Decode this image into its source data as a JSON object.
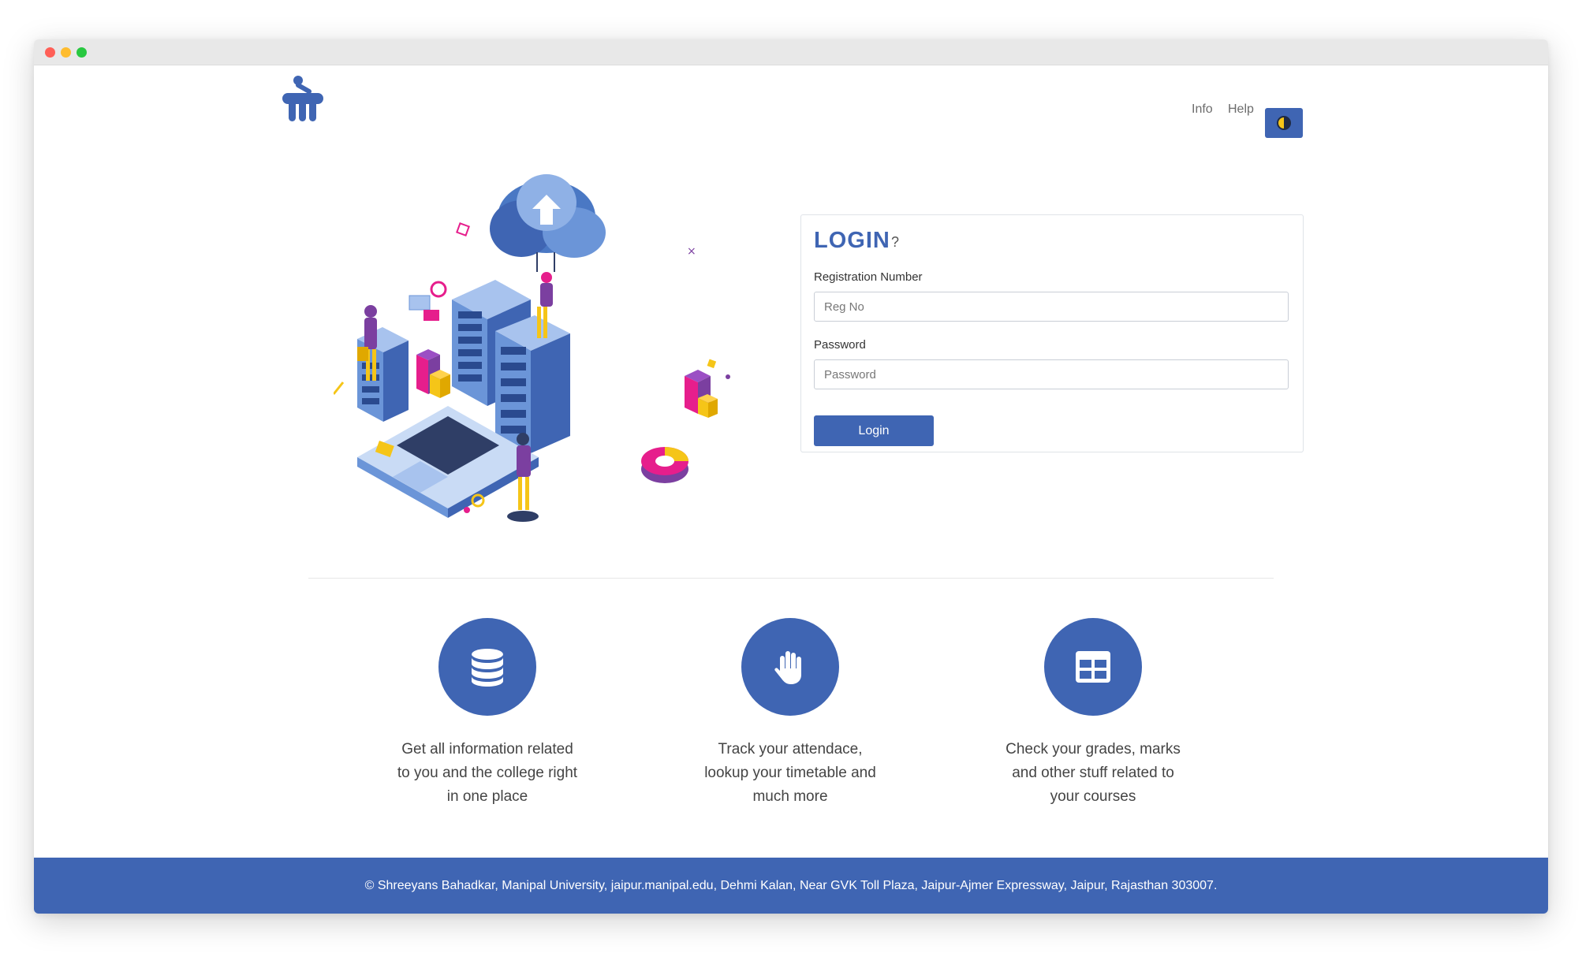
{
  "nav": {
    "info_label": "Info",
    "help_label": "Help",
    "theme_toggle_icon": "contrast-icon"
  },
  "login": {
    "title": "LOGIN",
    "help_mark": "?",
    "reg_label": "Registration Number",
    "reg_placeholder": "Reg No",
    "reg_value": "",
    "password_label": "Password",
    "password_placeholder": "Password",
    "password_value": "",
    "button_label": "Login"
  },
  "features": [
    {
      "icon": "database-icon",
      "lines": [
        "Get all information related",
        "to you and the college right",
        "in one place"
      ]
    },
    {
      "icon": "hand-icon",
      "lines": [
        "Track your attendace,",
        "lookup your timetable and",
        "much more"
      ]
    },
    {
      "icon": "table-icon",
      "lines": [
        "Check your grades, marks",
        "and other stuff related to",
        "your courses"
      ]
    }
  ],
  "footer": {
    "text": "© Shreeyans Bahadkar, Manipal University, jaipur.manipal.edu, Dehmi Kalan, Near GVK Toll Plaza, Jaipur-Ajmer Expressway, Jaipur, Rajasthan 303007."
  },
  "colors": {
    "accent": "#3f65b3",
    "illustration_magenta": "#e61e8c",
    "illustration_yellow": "#f5c518",
    "illustration_purple": "#7b3fa0"
  }
}
